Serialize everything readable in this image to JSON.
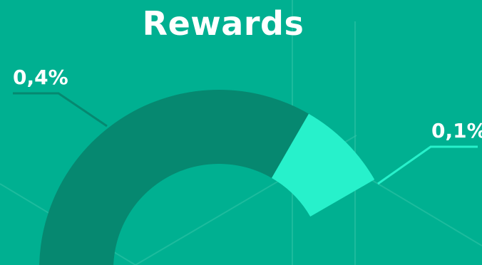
{
  "chart_data": {
    "type": "pie",
    "style": "donut",
    "title": "Rewards",
    "slices": [
      {
        "label": "0,4%",
        "value": 0.4,
        "color": "#068870"
      },
      {
        "label": "0,1%",
        "value": 0.1,
        "color": "#27f1cb"
      }
    ],
    "legend": "none",
    "grid": false
  },
  "colors": {
    "background": "#00b091",
    "decor_lines": "#33c4a8",
    "leader_0": "#068870",
    "leader_1": "#27f1cb",
    "text": "#ffffff"
  }
}
